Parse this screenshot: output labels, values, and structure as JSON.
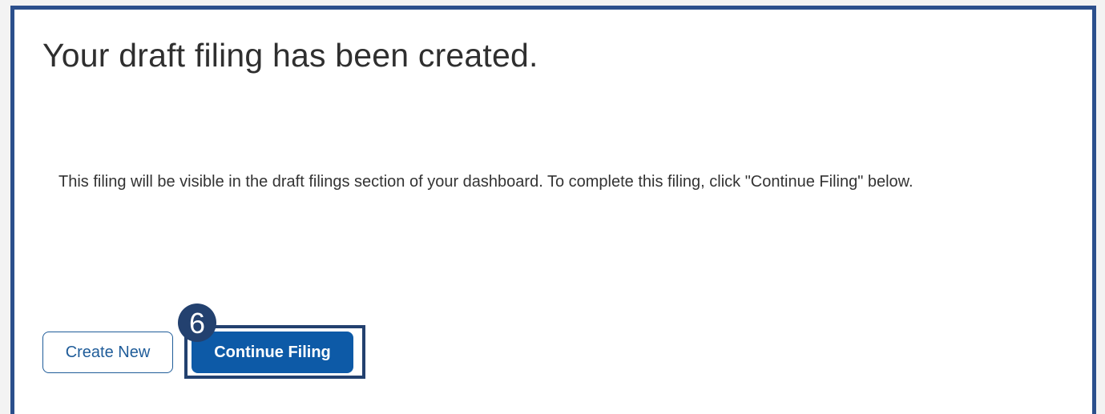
{
  "dialog": {
    "title": "Your draft filing has been created.",
    "message": "This filing will be visible in the draft filings section of your dashboard. To complete this filing, click \"Continue Filing\" below."
  },
  "actions": {
    "create_new_label": "Create New",
    "continue_filing_label": "Continue Filing"
  },
  "annotation": {
    "step_number": "6"
  },
  "colors": {
    "frame_border": "#2b4f8c",
    "primary_button": "#0d5aa7",
    "highlight": "#23416f",
    "text": "#2f2f2f"
  }
}
